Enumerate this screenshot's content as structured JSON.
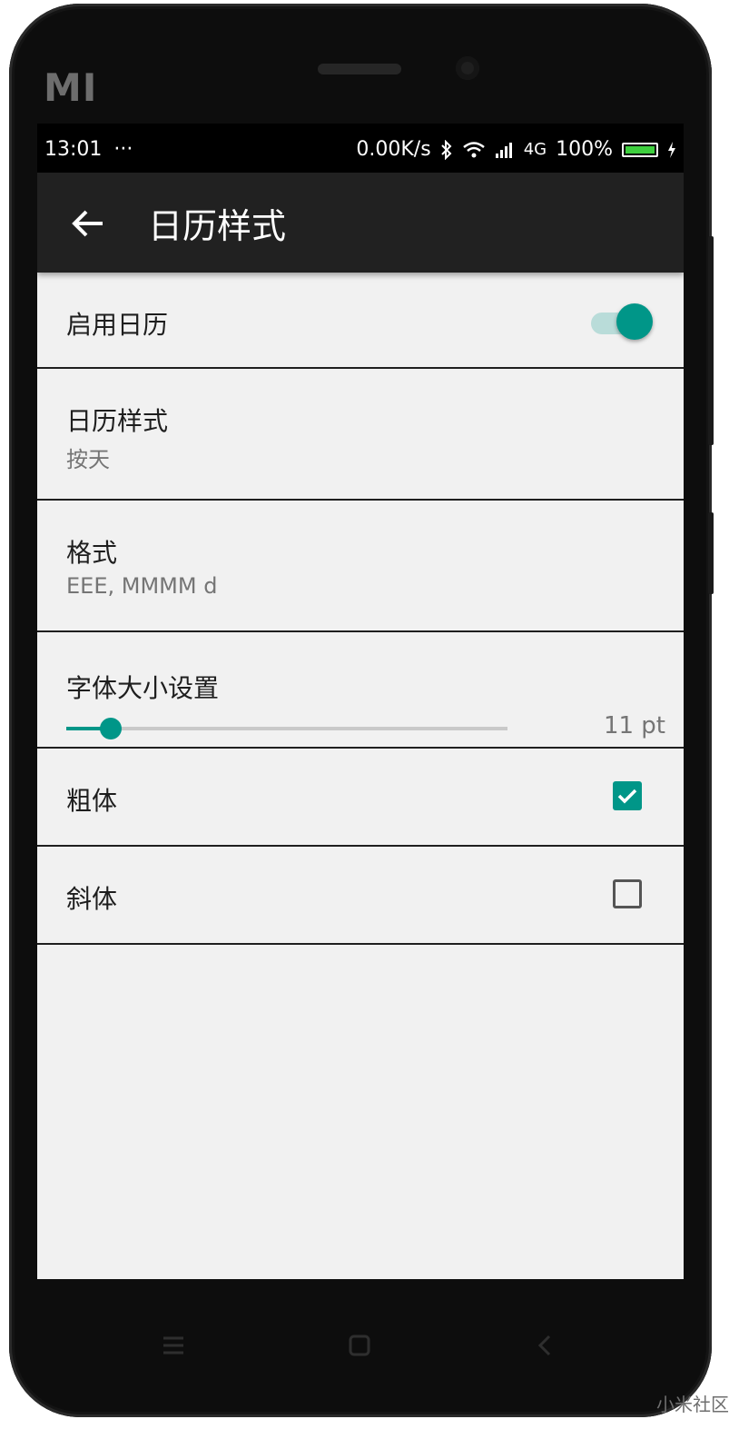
{
  "device": {
    "brand_logo": "MI"
  },
  "status_bar": {
    "time": "13:01",
    "notification_dots": "···",
    "network_speed": "0.00K/s",
    "network_type": "4G",
    "battery": "100%",
    "battery_level": 1.0,
    "icons": [
      "bluetooth-icon",
      "wifi-icon",
      "signal-icon",
      "battery-icon",
      "charging-icon"
    ]
  },
  "app_bar": {
    "title": "日历样式",
    "back_icon": "arrow-left-icon"
  },
  "settings": {
    "enable_calendar": {
      "label": "启用日历",
      "enabled": true
    },
    "calendar_style": {
      "label": "日历样式",
      "value": "按天"
    },
    "format": {
      "label": "格式",
      "value": "EEE, MMMM d"
    },
    "font_size": {
      "label": "字体大小设置",
      "value": "11 pt",
      "slider_fraction": 0.1
    },
    "bold": {
      "label": "粗体",
      "checked": true
    },
    "italic": {
      "label": "斜体",
      "checked": false
    }
  },
  "nav_bar": {
    "icons": [
      "menu-icon",
      "home-icon",
      "back-icon"
    ]
  },
  "watermark": "小米社区",
  "colors": {
    "accent": "#009688",
    "app_bar": "#212121",
    "background": "#f1f1f1"
  }
}
